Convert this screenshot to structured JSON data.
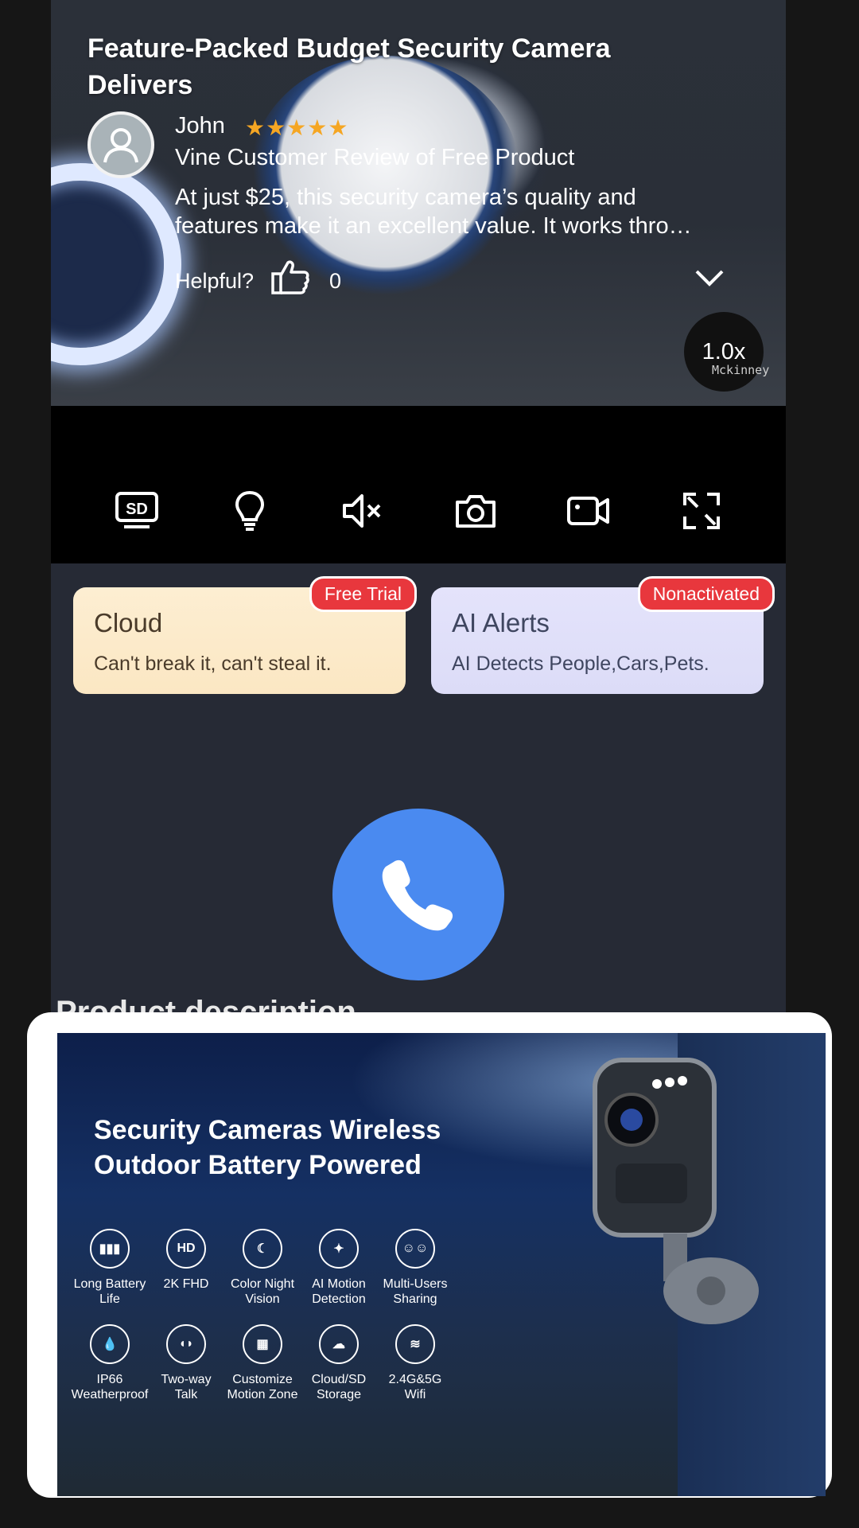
{
  "review": {
    "title": "Feature-Packed Budget Security Camera Delivers",
    "reviewer": "John",
    "rating_stars": "★★★★★",
    "rating": 5,
    "vine_label": "Vine Customer Review of Free Product",
    "snippet_line1": "At just $25, this security camera’s quality and",
    "snippet_line2": "features make it an excellent value. It works thro…",
    "helpful_label": "Helpful?",
    "helpful_count": "0",
    "speed": "1.0x",
    "watermark": "Mckinney"
  },
  "controls": [
    {
      "icon": "sd-icon"
    },
    {
      "icon": "light-bulb-icon"
    },
    {
      "icon": "mute-icon"
    },
    {
      "icon": "camera-icon"
    },
    {
      "icon": "video-record-icon"
    },
    {
      "icon": "fullscreen-icon"
    }
  ],
  "cards": {
    "cloud": {
      "title": "Cloud",
      "subtitle": "Can't break it, can't steal it.",
      "badge": "Free Trial"
    },
    "ai": {
      "title": "AI Alerts",
      "subtitle": "AI Detects People,Cars,Pets.",
      "badge": "Nonactivated"
    }
  },
  "call_button": {
    "icon": "phone-icon"
  },
  "product": {
    "partial_heading": "Product description",
    "title_line1": "Security Cameras Wireless",
    "title_line2": "Outdoor Battery Powered",
    "features": [
      {
        "icon": "battery-icon",
        "glyph": "▮▮▮",
        "line1": "Long Battery",
        "line2": "Life"
      },
      {
        "icon": "hd-icon",
        "glyph": "HD",
        "line1": "2K FHD",
        "line2": ""
      },
      {
        "icon": "night-vision-icon",
        "glyph": "☾",
        "line1": "Color Night",
        "line2": "Vision"
      },
      {
        "icon": "motion-icon",
        "glyph": "✦",
        "line1": "AI Motion",
        "line2": "Detection"
      },
      {
        "icon": "users-icon",
        "glyph": "☺☺",
        "line1": "Multi-Users",
        "line2": "Sharing"
      },
      {
        "icon": "water-drop-icon",
        "glyph": "💧",
        "line1": "IP66",
        "line2": "Weatherproof"
      },
      {
        "icon": "two-way-talk-icon",
        "glyph": "◖◗",
        "line1": "Two-way",
        "line2": "Talk"
      },
      {
        "icon": "motion-zone-icon",
        "glyph": "▦",
        "line1": "Customize",
        "line2": "Motion Zone"
      },
      {
        "icon": "cloud-storage-icon",
        "glyph": "☁",
        "line1": "Cloud/SD",
        "line2": "Storage"
      },
      {
        "icon": "wifi-icon",
        "glyph": "≋",
        "line1": "2.4G&5G",
        "line2": "Wifi"
      }
    ]
  }
}
